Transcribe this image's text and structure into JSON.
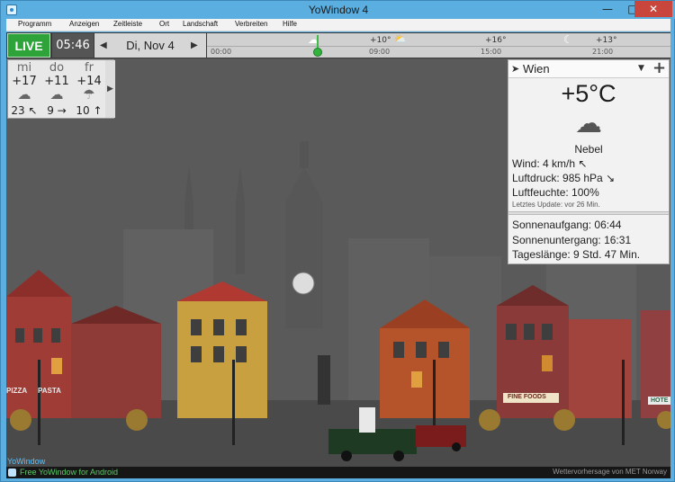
{
  "window": {
    "title": "YoWindow 4",
    "minimize": "—",
    "maximize": "□",
    "close": "✕"
  },
  "menu": [
    "Programm",
    "Anzeigen",
    "Zeitleiste",
    "Ort",
    "Landschaft",
    "Verbreiten",
    "Hilfe"
  ],
  "timeline": {
    "live": "LIVE",
    "time": "05:46",
    "prev": "◀",
    "date": "Di, Nov 4",
    "next": "▶",
    "ticks": [
      "00:00",
      "09:00",
      "15:00",
      "21:00"
    ],
    "temps": [
      "+10°",
      "+16°",
      "+13°"
    ],
    "icons": [
      "cloud-icon",
      "partly-cloudy-icon",
      "moon-icon"
    ]
  },
  "forecast": [
    {
      "day": "mi",
      "temp": "+17",
      "icon": "cloud-icon",
      "wind": "23 ↖"
    },
    {
      "day": "do",
      "temp": "+11",
      "icon": "cloud-icon",
      "wind": "9 →"
    },
    {
      "day": "fr",
      "temp": "+14",
      "icon": "rain-icon",
      "wind": "10 ↑"
    }
  ],
  "forecast_next": "▶",
  "current": {
    "location": "Wien",
    "temperature": "+5°C",
    "icon": "fog-icon",
    "description": "Nebel",
    "wind": "Wind:  4 km/h ↖",
    "pressure": "Luftdruck:  985 hPa ↘",
    "humidity": "Luftfeuchte:  100%",
    "updated": "Letztes Update:  vor 26 Min.",
    "sunrise": "Sonnenaufgang:  06:44",
    "sunset": "Sonnenuntergang:  16:31",
    "daylength": "Tageslänge:  9 Std. 47 Min."
  },
  "scene": {
    "brand": "YoWindow",
    "shops": [
      "PIZZA",
      "PASTA",
      "FINE FOODS",
      "HOTE"
    ]
  },
  "footer": {
    "promo": "Free YoWindow for Android",
    "credit": "Wettervorhersage von MET Norway"
  }
}
